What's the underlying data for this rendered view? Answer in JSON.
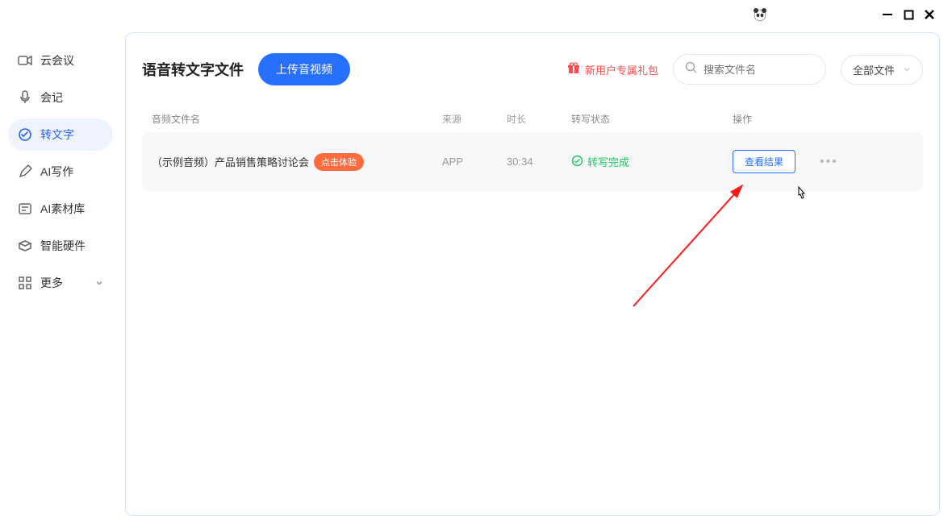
{
  "sidebar": {
    "items": [
      {
        "label": "云会议",
        "icon": "video-icon"
      },
      {
        "label": "会记",
        "icon": "mic-icon"
      },
      {
        "label": "转文字",
        "icon": "transcribe-icon"
      },
      {
        "label": "AI写作",
        "icon": "pen-icon"
      },
      {
        "label": "AI素材库",
        "icon": "library-icon"
      },
      {
        "label": "智能硬件",
        "icon": "hardware-icon"
      },
      {
        "label": "更多",
        "icon": "grid-icon"
      }
    ]
  },
  "main": {
    "title": "语音转文字文件",
    "upload_label": "上传音视频",
    "promo_text": "新用户专属礼包",
    "search_placeholder": "搜索文件名",
    "dropdown_label": "全部文件"
  },
  "table": {
    "headers": {
      "name": "音频文件名",
      "source": "来源",
      "duration": "时长",
      "status": "转写状态",
      "action": "操作"
    },
    "rows": [
      {
        "name": "（示例音频）产品销售策略讨论会",
        "badge": "点击体验",
        "source": "APP",
        "duration": "30:34",
        "status_text": "转写完成",
        "action_label": "查看结果"
      }
    ]
  },
  "colors": {
    "primary": "#2770ff",
    "danger": "#ff4d4f",
    "success": "#22c55e",
    "badge": "#ff6b3d"
  }
}
